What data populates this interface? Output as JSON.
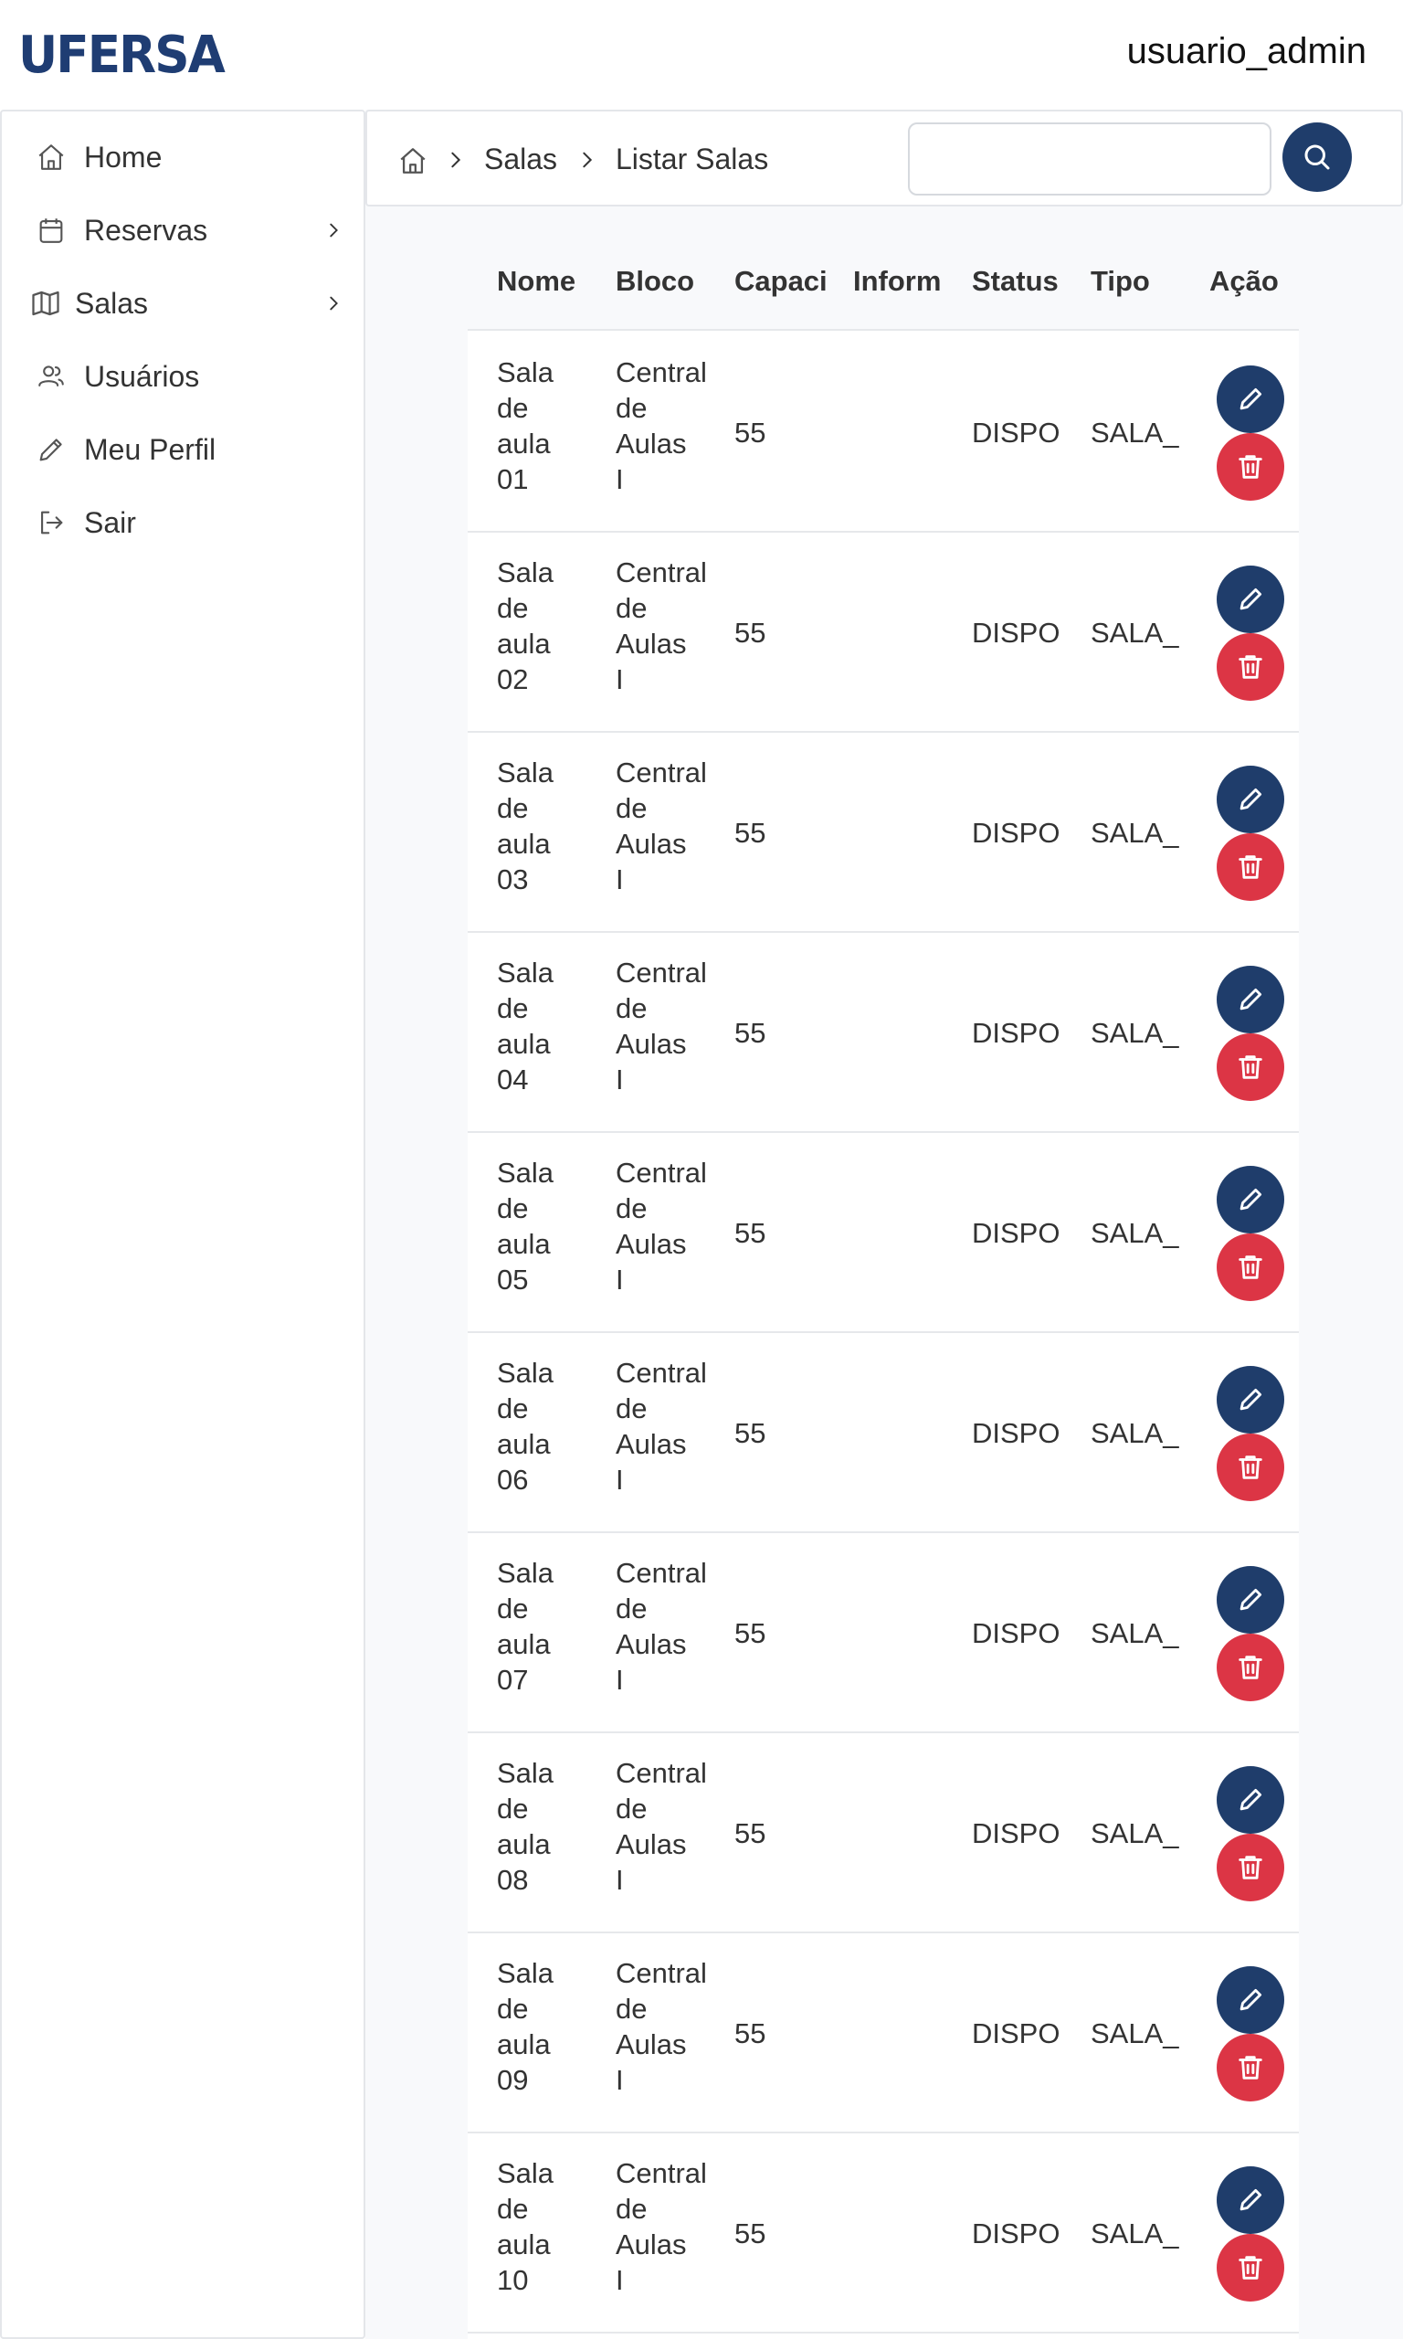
{
  "header": {
    "logo_text": "UFERSA",
    "username": "usuario_admin"
  },
  "sidebar": {
    "items": [
      {
        "label": "Home",
        "icon": "home-icon"
      },
      {
        "label": "Reservas",
        "icon": "calendar-icon"
      },
      {
        "label": "Salas",
        "icon": "map-icon"
      },
      {
        "label": "Usuários",
        "icon": "users-icon"
      },
      {
        "label": "Meu Perfil",
        "icon": "pencil-icon"
      },
      {
        "label": "Sair",
        "icon": "logout-icon"
      }
    ]
  },
  "breadcrumb": {
    "items": [
      "Salas",
      "Listar Salas"
    ]
  },
  "search": {
    "value": "",
    "placeholder": ""
  },
  "table": {
    "headers": [
      "Nome",
      "Bloco",
      "Capaci",
      "Inform",
      "Status",
      "Tipo",
      "Ação"
    ],
    "rows": [
      {
        "nome": [
          "Sala",
          "de",
          "aula",
          "01"
        ],
        "bloco": [
          "Central",
          "de",
          "Aulas",
          "I"
        ],
        "capacidade": "55",
        "informacoes": "",
        "status": "DISPON",
        "tipo": "SALA_"
      },
      {
        "nome": [
          "Sala",
          "de",
          "aula",
          "02"
        ],
        "bloco": [
          "Central",
          "de",
          "Aulas",
          "I"
        ],
        "capacidade": "55",
        "informacoes": "",
        "status": "DISPON",
        "tipo": "SALA_"
      },
      {
        "nome": [
          "Sala",
          "de",
          "aula",
          "03"
        ],
        "bloco": [
          "Central",
          "de",
          "Aulas",
          "I"
        ],
        "capacidade": "55",
        "informacoes": "",
        "status": "DISPON",
        "tipo": "SALA_"
      },
      {
        "nome": [
          "Sala",
          "de",
          "aula",
          "04"
        ],
        "bloco": [
          "Central",
          "de",
          "Aulas",
          "I"
        ],
        "capacidade": "55",
        "informacoes": "",
        "status": "DISPON",
        "tipo": "SALA_"
      },
      {
        "nome": [
          "Sala",
          "de",
          "aula",
          "05"
        ],
        "bloco": [
          "Central",
          "de",
          "Aulas",
          "I"
        ],
        "capacidade": "55",
        "informacoes": "",
        "status": "DISPON",
        "tipo": "SALA_"
      },
      {
        "nome": [
          "Sala",
          "de",
          "aula",
          "06"
        ],
        "bloco": [
          "Central",
          "de",
          "Aulas",
          "I"
        ],
        "capacidade": "55",
        "informacoes": "",
        "status": "DISPON",
        "tipo": "SALA_"
      },
      {
        "nome": [
          "Sala",
          "de",
          "aula",
          "07"
        ],
        "bloco": [
          "Central",
          "de",
          "Aulas",
          "I"
        ],
        "capacidade": "55",
        "informacoes": "",
        "status": "DISPON",
        "tipo": "SALA_"
      },
      {
        "nome": [
          "Sala",
          "de",
          "aula",
          "08"
        ],
        "bloco": [
          "Central",
          "de",
          "Aulas",
          "I"
        ],
        "capacidade": "55",
        "informacoes": "",
        "status": "DISPON",
        "tipo": "SALA_"
      },
      {
        "nome": [
          "Sala",
          "de",
          "aula",
          "09"
        ],
        "bloco": [
          "Central",
          "de",
          "Aulas",
          "I"
        ],
        "capacidade": "55",
        "informacoes": "",
        "status": "DISPON",
        "tipo": "SALA_"
      },
      {
        "nome": [
          "Sala",
          "de",
          "aula",
          "10"
        ],
        "bloco": [
          "Central",
          "de",
          "Aulas",
          "I"
        ],
        "capacidade": "55",
        "informacoes": "",
        "status": "DISPON",
        "tipo": "SALA_"
      }
    ],
    "actions": {
      "edit_icon": "pencil-icon",
      "delete_icon": "trash-icon"
    }
  },
  "colors": {
    "brand": "#1f3d6b",
    "danger": "#dc3545",
    "border": "#e4e6ea",
    "page_bg": "#f8f9fb"
  }
}
